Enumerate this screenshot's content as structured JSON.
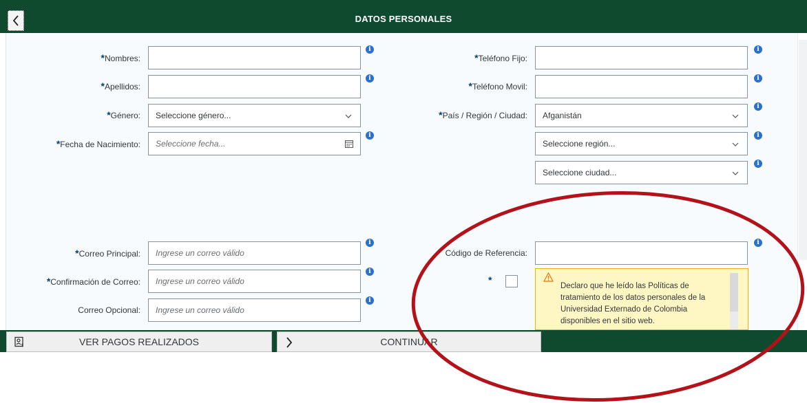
{
  "header": {
    "title": "DATOS PERSONALES",
    "back_icon": "chevron-left-icon"
  },
  "left_fields": {
    "nombres": {
      "label": "Nombres:",
      "value": "",
      "placeholder": ""
    },
    "apellidos": {
      "label": "Apellidos:",
      "value": "",
      "placeholder": ""
    },
    "genero": {
      "label": "Género:",
      "selected": "Seleccione género..."
    },
    "fecha_nacimiento": {
      "label": "Fecha de Nacimiento:",
      "placeholder": "Seleccione fecha..."
    },
    "correo_principal": {
      "label": "Correo Principal:",
      "placeholder": "Ingrese un correo válido"
    },
    "confirmacion_correo": {
      "label": "Confirmación de Correo:",
      "placeholder": "Ingrese un correo válido"
    },
    "correo_opcional": {
      "label": "Correo Opcional:",
      "placeholder": "Ingrese un correo válido"
    }
  },
  "right_fields": {
    "telefono_fijo": {
      "label": "Teléfono Fijo:",
      "value": ""
    },
    "telefono_movil": {
      "label": "Teléfono Movil:",
      "value": ""
    },
    "pais_region_ciudad": {
      "label": "País / Región / Ciudad:",
      "pais_selected": "Afganistán",
      "region_selected": "Seleccione región...",
      "ciudad_selected": "Seleccione ciudad..."
    },
    "codigo_referencia": {
      "label": "Código de Referencia:",
      "value": ""
    }
  },
  "required_marker": "*",
  "consent": {
    "text": "Declaro que he leído las Políticas de tratamiento de los datos personales de la Universidad Externado de Colombia disponibles en el sitio web."
  },
  "footer": {
    "ver_pagos_label": "VER PAGOS REALIZADOS",
    "continuar_label": "CONTINUAR"
  },
  "colors": {
    "brand_green": "#0f4a2e",
    "info_blue": "#2b70c9",
    "warning_bg": "#fef7c4",
    "warning_border": "#e9b20f",
    "annotation_red": "#b3121a"
  }
}
